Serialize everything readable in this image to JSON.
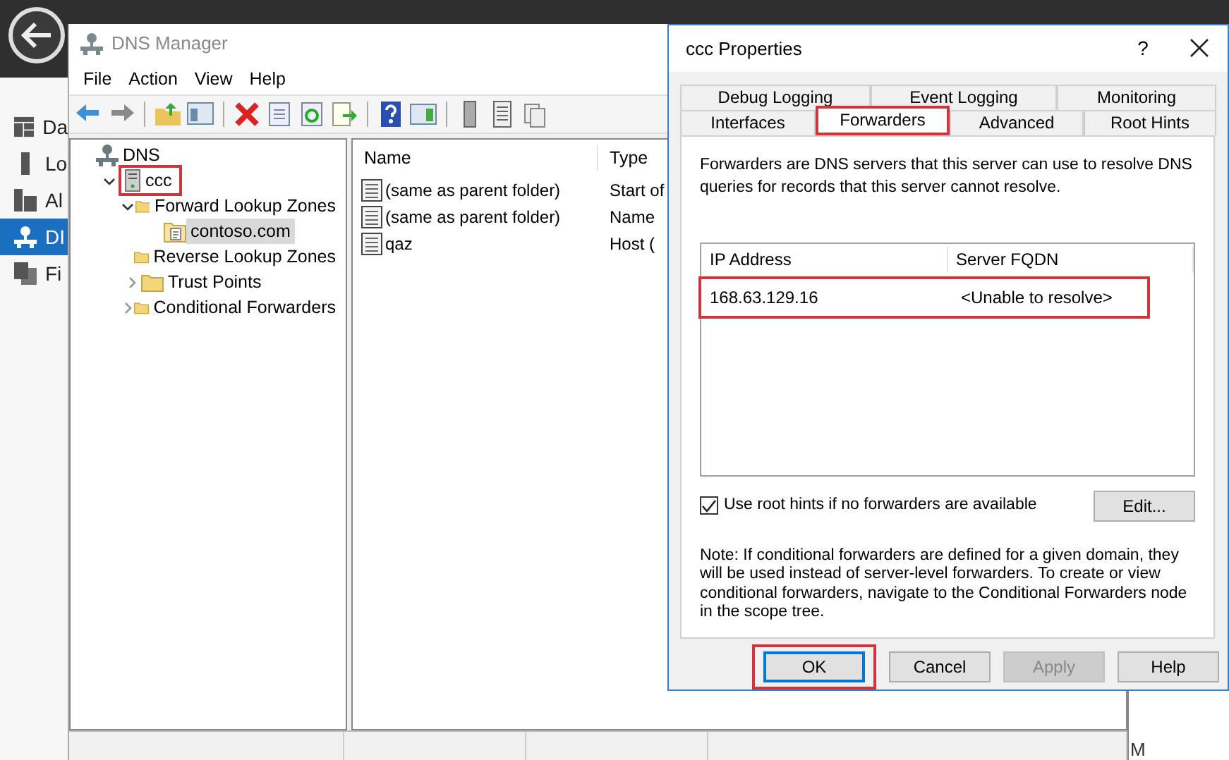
{
  "desktop": {
    "sidebar": [
      {
        "label": "Da",
        "selected": false
      },
      {
        "label": "Lo",
        "selected": false
      },
      {
        "label": "Al",
        "selected": false
      },
      {
        "label": "DI",
        "selected": true
      },
      {
        "label": "Fi",
        "selected": false
      }
    ],
    "corner_text": "M"
  },
  "dns_manager": {
    "title": "DNS Manager",
    "menu": [
      "File",
      "Action",
      "View",
      "Help"
    ],
    "tree": [
      {
        "label": "DNS",
        "kind": "root",
        "selected": false,
        "highlighted": false,
        "children": [
          {
            "label": "ccc",
            "kind": "server",
            "expanded": true,
            "selected": false,
            "highlighted": true,
            "children": [
              {
                "label": "Forward Lookup Zones",
                "kind": "folder",
                "expanded": true,
                "selected": false,
                "highlighted": false,
                "children": [
                  {
                    "label": "contoso.com",
                    "kind": "zone",
                    "selected": true,
                    "highlighted": false
                  }
                ]
              },
              {
                "label": "Reverse Lookup Zones",
                "kind": "folder",
                "selected": false,
                "highlighted": false
              },
              {
                "label": "Trust Points",
                "kind": "folder",
                "expanded": false,
                "selected": false,
                "highlighted": false
              },
              {
                "label": "Conditional Forwarders",
                "kind": "folder",
                "expanded": false,
                "selected": false,
                "highlighted": false
              }
            ]
          }
        ]
      }
    ],
    "columns": [
      "Name",
      "Type"
    ],
    "rows": [
      {
        "name": "(same as parent folder)",
        "type": "Start of"
      },
      {
        "name": "(same as parent folder)",
        "type": "Name"
      },
      {
        "name": "qaz",
        "type": "Host ("
      }
    ]
  },
  "dialog": {
    "title": "ccc Properties",
    "help_button": "?",
    "tab_rows": [
      [
        {
          "label": "Debug Logging",
          "selected": false,
          "highlighted": false
        },
        {
          "label": "Event Logging",
          "selected": false,
          "highlighted": false
        },
        {
          "label": "Monitoring",
          "selected": false,
          "highlighted": false
        }
      ],
      [
        {
          "label": "Interfaces",
          "selected": false,
          "highlighted": false
        },
        {
          "label": "Forwarders",
          "selected": true,
          "highlighted": true
        },
        {
          "label": "Advanced",
          "selected": false,
          "highlighted": false
        },
        {
          "label": "Root Hints",
          "selected": false,
          "highlighted": false
        }
      ]
    ],
    "description": "Forwarders are DNS servers that this server can use to resolve DNS queries for records that this server cannot resolve.",
    "columns": [
      "IP Address",
      "Server FQDN"
    ],
    "rows": [
      {
        "ip": "168.63.129.16",
        "fqdn": "<Unable to resolve>",
        "highlighted": true
      }
    ],
    "checkbox": {
      "label": "Use root hints if no forwarders are available",
      "checked": true
    },
    "edit_button": "Edit...",
    "note": "Note: If conditional forwarders are defined for a given domain, they will be used instead of server-level forwarders.  To create or view conditional forwarders, navigate to the Conditional Forwarders node in the scope tree.",
    "buttons": [
      {
        "label": "OK",
        "default": true,
        "disabled": false,
        "highlighted": true
      },
      {
        "label": "Cancel",
        "default": false,
        "disabled": false,
        "highlighted": false
      },
      {
        "label": "Apply",
        "default": false,
        "disabled": true,
        "highlighted": false
      },
      {
        "label": "Help",
        "default": false,
        "disabled": false,
        "highlighted": false
      }
    ]
  }
}
